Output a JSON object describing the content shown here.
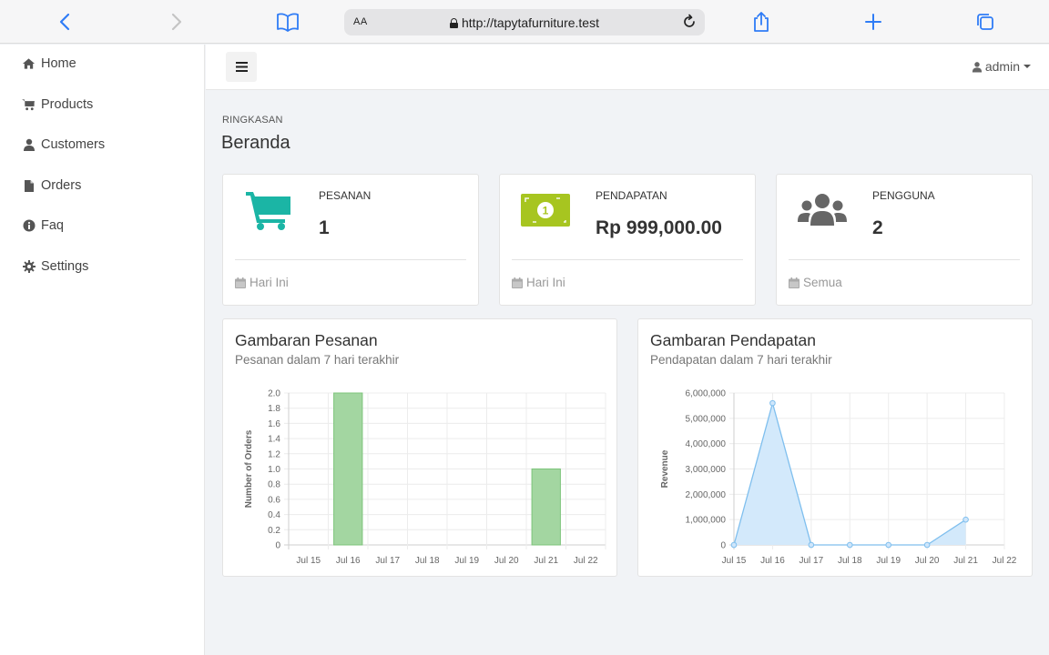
{
  "browser": {
    "url_text": "http://tapytafurniture.test",
    "text_size_label": "AA"
  },
  "sidebar": {
    "items": [
      {
        "label": "Home",
        "icon": "home-icon"
      },
      {
        "label": "Products",
        "icon": "cart-icon"
      },
      {
        "label": "Customers",
        "icon": "user-icon"
      },
      {
        "label": "Orders",
        "icon": "file-icon"
      },
      {
        "label": "Faq",
        "icon": "info-icon"
      },
      {
        "label": "Settings",
        "icon": "gear-icon"
      }
    ]
  },
  "header": {
    "user_label": "admin"
  },
  "page": {
    "subtitle": "RINGKASAN",
    "title": "Beranda"
  },
  "stats": [
    {
      "label": "PESANAN",
      "value": "1",
      "footer": "Hari Ini",
      "icon": "shopping-cart-icon",
      "color": "#1bb5a5"
    },
    {
      "label": "PENDAPATAN",
      "value": "Rp 999,000.00",
      "footer": "Hari Ini",
      "icon": "money-icon",
      "color": "#a7c520"
    },
    {
      "label": "PENGGUNA",
      "value": "2",
      "footer": "Semua",
      "icon": "users-icon",
      "color": "#666666"
    }
  ],
  "charts": {
    "orders": {
      "title": "Gambaran Pesanan",
      "subtitle": "Pesanan dalam 7 hari terakhir"
    },
    "revenue": {
      "title": "Gambaran Pendapatan",
      "subtitle": "Pendapatan dalam 7 hari terakhir"
    }
  },
  "chart_data": [
    {
      "type": "bar",
      "categories": [
        "Jul 15",
        "Jul 16",
        "Jul 17",
        "Jul 18",
        "Jul 19",
        "Jul 20",
        "Jul 21",
        "Jul 22"
      ],
      "values": [
        0,
        2,
        0,
        0,
        0,
        0,
        1,
        0
      ],
      "title": "",
      "xlabel": "",
      "ylabel": "Number of Orders",
      "ylim": [
        0,
        2
      ],
      "yticks": [
        "0",
        "0.2",
        "0.4",
        "0.6",
        "0.8",
        "1.0",
        "1.2",
        "1.4",
        "1.6",
        "1.8",
        "2.0"
      ],
      "grid": true,
      "color": "#a3d6a1",
      "border_color": "#7cc47a"
    },
    {
      "type": "area",
      "categories": [
        "Jul 15",
        "Jul 16",
        "Jul 17",
        "Jul 18",
        "Jul 19",
        "Jul 20",
        "Jul 21",
        "Jul 22"
      ],
      "values": [
        0,
        5600000,
        0,
        0,
        0,
        0,
        1000000
      ],
      "title": "",
      "xlabel": "",
      "ylabel": "Revenue",
      "ylim": [
        0,
        6000000
      ],
      "yticks": [
        "0",
        "1,000,000",
        "2,000,000",
        "3,000,000",
        "4,000,000",
        "5,000,000",
        "6,000,000"
      ],
      "grid": true,
      "color": "#d3e9fb",
      "border_color": "#7fbfee"
    }
  ]
}
